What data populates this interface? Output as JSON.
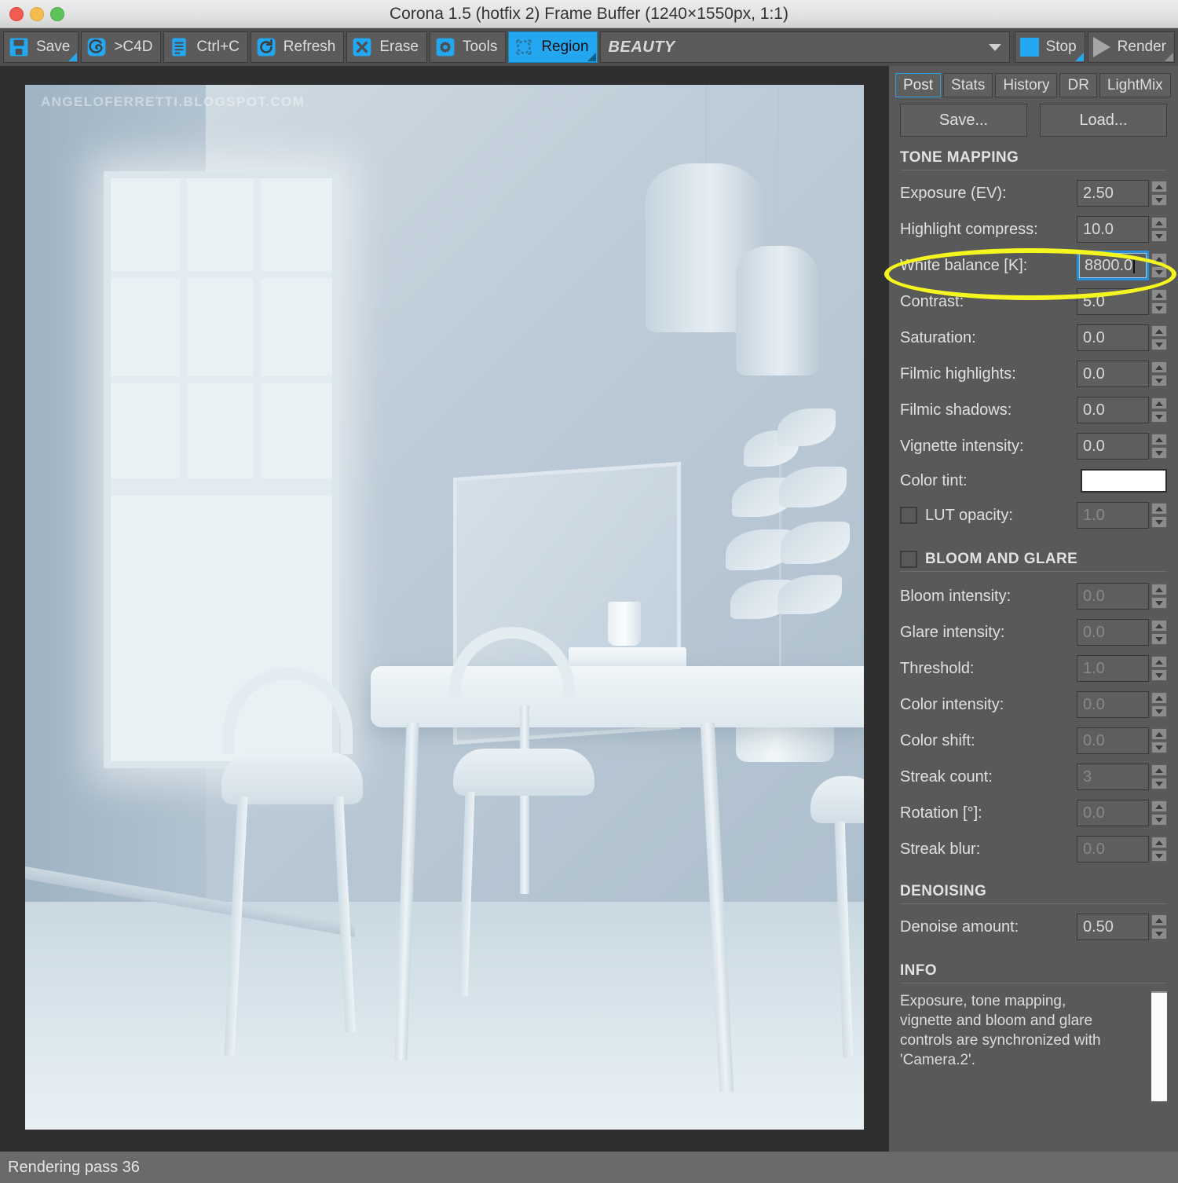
{
  "window": {
    "title": "Corona 1.5 (hotfix 2) Frame Buffer (1240×1550px, 1:1)",
    "traffic_lights": [
      "close",
      "minimize",
      "zoom"
    ]
  },
  "toolbar": {
    "buttons": [
      {
        "label": "Save",
        "icon": "floppy-disk-icon",
        "active": false,
        "has_corner": true
      },
      {
        "label": ">C4D",
        "icon": "cinema4d-icon",
        "active": false,
        "has_corner": false
      },
      {
        "label": "Ctrl+C",
        "icon": "clipboard-icon",
        "active": false,
        "has_corner": false
      },
      {
        "label": "Refresh",
        "icon": "refresh-icon",
        "active": false,
        "has_corner": false
      },
      {
        "label": "Erase",
        "icon": "x-icon",
        "active": false,
        "has_corner": false
      },
      {
        "label": "Tools",
        "icon": "gear-icon",
        "active": false,
        "has_corner": false
      },
      {
        "label": "Region",
        "icon": "region-icon",
        "active": true,
        "has_corner": true
      }
    ],
    "pass_combo": {
      "value": "BEAUTY",
      "caret": "chevron-down-icon"
    },
    "stop": {
      "label": "Stop",
      "icon": "stop-square-icon",
      "has_corner": true
    },
    "render": {
      "label": "Render",
      "icon": "play-triangle-icon",
      "has_corner": true
    }
  },
  "viewport": {
    "watermark": "ANGELOFERRETTI.BLOGSPOT.COM"
  },
  "panel": {
    "tabs": [
      {
        "label": "Post",
        "selected": true
      },
      {
        "label": "Stats",
        "selected": false
      },
      {
        "label": "History",
        "selected": false
      },
      {
        "label": "DR",
        "selected": false
      },
      {
        "label": "LightMix",
        "selected": false
      }
    ],
    "save_button": "Save...",
    "load_button": "Load...",
    "sections": {
      "tone_mapping": {
        "title": "TONE MAPPING",
        "controls": [
          {
            "label": "Exposure (EV):",
            "value": "2.50",
            "type": "spinner",
            "disabled": false,
            "focused": false
          },
          {
            "label": "Highlight compress:",
            "value": "10.0",
            "type": "spinner",
            "disabled": false,
            "focused": false
          },
          {
            "label": "White balance [K]:",
            "value": "8800.0",
            "type": "spinner",
            "disabled": false,
            "focused": true
          },
          {
            "label": "Contrast:",
            "value": "5.0",
            "type": "spinner",
            "disabled": false,
            "focused": false
          },
          {
            "label": "Saturation:",
            "value": "0.0",
            "type": "spinner",
            "disabled": false,
            "focused": false
          },
          {
            "label": "Filmic highlights:",
            "value": "0.0",
            "type": "spinner",
            "disabled": false,
            "focused": false
          },
          {
            "label": "Filmic shadows:",
            "value": "0.0",
            "type": "spinner",
            "disabled": false,
            "focused": false
          },
          {
            "label": "Vignette intensity:",
            "value": "0.0",
            "type": "spinner",
            "disabled": false,
            "focused": false
          },
          {
            "label": "Color tint:",
            "value": "#ffffff",
            "type": "color",
            "disabled": false,
            "focused": false
          },
          {
            "label": "LUT opacity:",
            "value": "1.0",
            "type": "spinner",
            "disabled": true,
            "focused": false,
            "checkbox": false
          }
        ]
      },
      "bloom_and_glare": {
        "title": "BLOOM AND GLARE",
        "enabled": false,
        "controls": [
          {
            "label": "Bloom intensity:",
            "value": "0.0",
            "type": "spinner",
            "disabled": true
          },
          {
            "label": "Glare intensity:",
            "value": "0.0",
            "type": "spinner",
            "disabled": true
          },
          {
            "label": "Threshold:",
            "value": "1.0",
            "type": "spinner",
            "disabled": true
          },
          {
            "label": "Color intensity:",
            "value": "0.0",
            "type": "spinner",
            "disabled": true
          },
          {
            "label": "Color shift:",
            "value": "0.0",
            "type": "spinner",
            "disabled": true
          },
          {
            "label": "Streak count:",
            "value": "3",
            "type": "spinner",
            "disabled": true
          },
          {
            "label": "Rotation [°]:",
            "value": "0.0",
            "type": "spinner",
            "disabled": true
          },
          {
            "label": "Streak blur:",
            "value": "0.0",
            "type": "spinner",
            "disabled": true
          }
        ]
      },
      "denoising": {
        "title": "DENOISING",
        "controls": [
          {
            "label": "Denoise amount:",
            "value": "0.50",
            "type": "spinner",
            "disabled": false
          }
        ]
      },
      "info": {
        "title": "INFO",
        "text": "Exposure, tone mapping,\nvignette and bloom and glare\ncontrols are synchronized with\n'Camera.2'."
      }
    }
  },
  "statusbar": {
    "text": "Rendering pass 36"
  },
  "annotation": {
    "shape": "ellipse",
    "color": "#f5f520",
    "targets": "White balance [K] field"
  },
  "colors": {
    "accent_blue": "#22a7f0",
    "panel_bg": "#595959",
    "toolbar_bg": "#4e4e4e",
    "viewport_bg": "#2f2f2f",
    "focus_blue": "#2b8fd8",
    "annotation_yellow": "#f5f520"
  }
}
